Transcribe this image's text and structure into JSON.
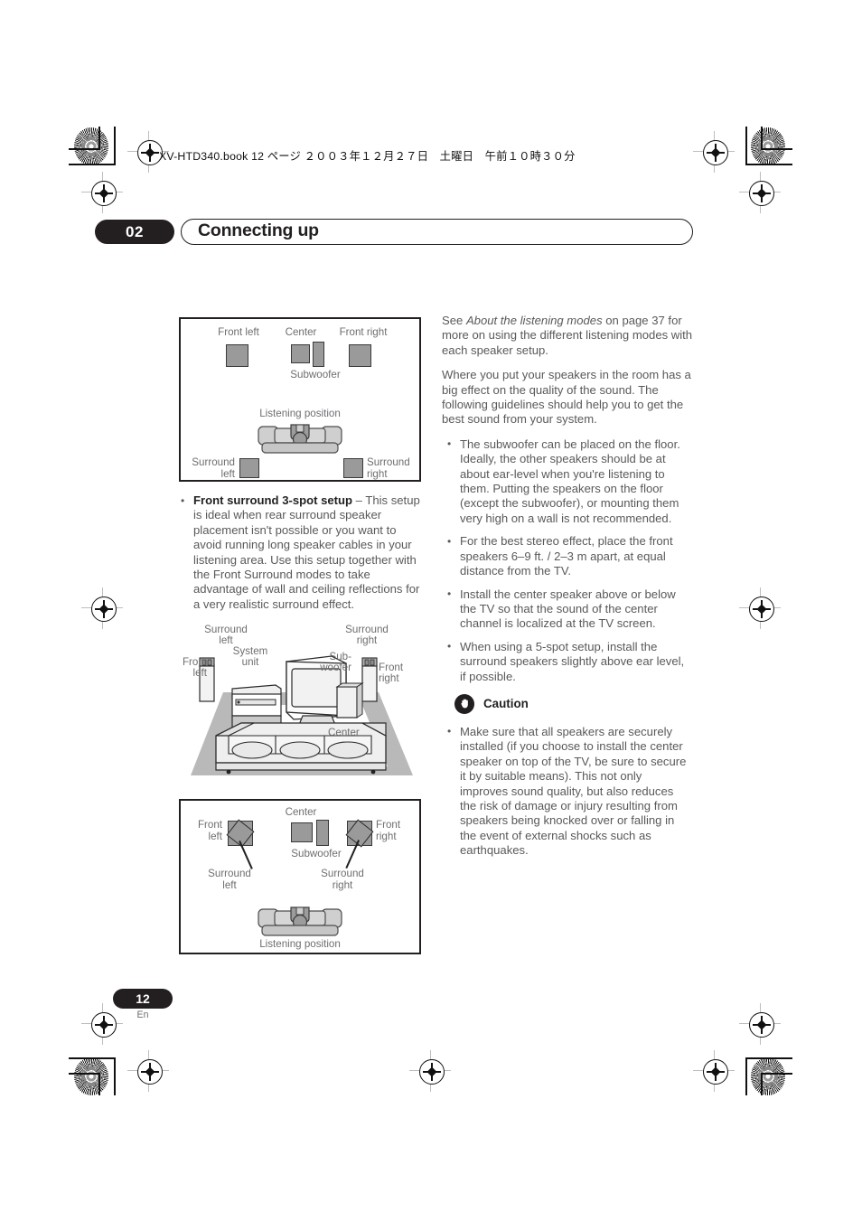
{
  "print_marks": {
    "book_line": "XV-HTD340.book  12 ページ  ２００３年１２月２７日　土曜日　午前１０時３０分"
  },
  "header": {
    "chapter_number": "02",
    "chapter_title": "Connecting up"
  },
  "footer": {
    "page_number": "12",
    "language": "En"
  },
  "left_column": {
    "bullets": [
      {
        "lead": "Front surround 3-spot setup",
        "text": " – This setup is ideal when rear surround speaker placement isn't possible or you want to avoid running long speaker cables in your listening area. Use this setup together with the Front Surround modes  to take advantage of wall and ceiling reflections for a very realistic surround effect."
      }
    ]
  },
  "right_column": {
    "paragraphs": [
      {
        "pre": "See ",
        "em": "About the listening modes",
        "post": " on page 37 for more on using the different listening modes with each speaker setup."
      },
      {
        "pre": "Where you put your speakers in the room has a big effect on the quality of the sound. The following guidelines should help you to get the best sound from your system.",
        "em": "",
        "post": ""
      }
    ],
    "bullets": [
      "The subwoofer can be placed on the floor. Ideally, the other speakers should be at about ear-level when you're listening to them. Putting the speakers on the floor (except the subwoofer), or mounting them very high on a wall is not recommended.",
      "For the best stereo effect, place the front speakers 6–9 ft. / 2–3 m apart, at equal distance from the TV.",
      "Install the center speaker above or below the TV so that the sound of the center channel is localized at the TV screen.",
      "When using a 5-spot setup, install the surround speakers slightly above ear level, if possible."
    ],
    "caution": {
      "icon": "hand-stop-icon",
      "label": "Caution",
      "bullets": [
        "Make sure that all speakers are securely installed (if you choose to install the center speaker on top of the TV, be sure to secure it by suitable means). This not only improves sound quality, but also reduces the risk of damage or injury resulting from speakers being knocked over or falling in the event of external shocks such as earthquakes."
      ]
    }
  },
  "diagram_top": {
    "name": "5-spot-speaker-layout-diagram",
    "labels": {
      "front_left": "Front left",
      "center": "Center",
      "front_right": "Front right",
      "subwoofer": "Subwoofer",
      "listening_position": "Listening position",
      "surround_left_1": "Surround",
      "surround_left_2": "left",
      "surround_right_1": "Surround",
      "surround_right_2": "right"
    }
  },
  "diagram_room": {
    "name": "room-perspective-illustration",
    "labels": {
      "surround_left_1": "Surround",
      "surround_left_2": "left",
      "surround_right_1": "Surround",
      "surround_right_2": "right",
      "front_left_1": "Front",
      "front_left_2": "left",
      "front_right_1": "Front",
      "front_right_2": "right",
      "system_unit_1": "System",
      "system_unit_2": "unit",
      "subwoofer_1": "Sub-",
      "subwoofer_2": "woofer",
      "center": "Center"
    }
  },
  "diagram_bottom": {
    "name": "front-surround-3-spot-layout-diagram",
    "labels": {
      "center": "Center",
      "subwoofer": "Subwoofer",
      "front_left_1": "Front",
      "front_left_2": "left",
      "front_right_1": "Front",
      "front_right_2": "right",
      "surround_left_1": "Surround",
      "surround_left_2": "left",
      "surround_right_1": "Surround",
      "surround_right_2": "right",
      "listening_position": "Listening position"
    }
  },
  "colors": {
    "ink": "#231f20",
    "body_text": "#58595b",
    "label_text": "#6d6e71",
    "speaker_fill": "#9a9a9a",
    "furniture_fill": "#d2d2d2",
    "rug_fill": "#b8b8b8"
  }
}
